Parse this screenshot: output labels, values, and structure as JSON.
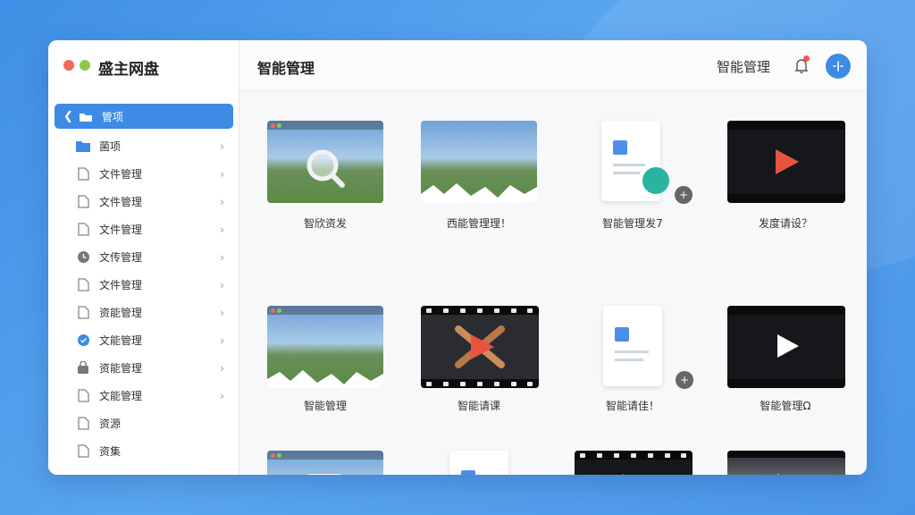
{
  "app": {
    "title": "盛主网盘"
  },
  "sidebar": {
    "items": [
      {
        "label": "管项",
        "icon": "folder-cloud-icon"
      },
      {
        "label": "菌项",
        "icon": "folder-icon"
      },
      {
        "label": "文件管理",
        "icon": "file-icon"
      },
      {
        "label": "文件管理",
        "icon": "file-icon"
      },
      {
        "label": "文件管理",
        "icon": "file-icon"
      },
      {
        "label": "文传管理",
        "icon": "clock-icon"
      },
      {
        "label": "文件管理",
        "icon": "file-icon"
      },
      {
        "label": "资能管理",
        "icon": "file-icon"
      },
      {
        "label": "文能管理",
        "icon": "check-circle-icon"
      },
      {
        "label": "资能管理",
        "icon": "lock-icon"
      },
      {
        "label": "文能管理",
        "icon": "file-icon"
      },
      {
        "label": "资源",
        "icon": "file-icon"
      },
      {
        "label": "资集",
        "icon": "file-icon"
      }
    ]
  },
  "header": {
    "title": "智能管理",
    "right_label": "智能管理"
  },
  "grid": {
    "items": [
      {
        "label": "智欣资发",
        "kind": "image-search"
      },
      {
        "label": "西能管理理！",
        "kind": "image"
      },
      {
        "label": "智能管理发7",
        "kind": "document-app"
      },
      {
        "label": "发度请设？",
        "kind": "video"
      },
      {
        "label": "智能管理",
        "kind": "image"
      },
      {
        "label": "智能请课",
        "kind": "video-film"
      },
      {
        "label": "智能请佳！",
        "kind": "document"
      },
      {
        "label": "智能管理Ω",
        "kind": "video"
      },
      {
        "label": "",
        "kind": "image-dialog"
      },
      {
        "label": "",
        "kind": "document"
      },
      {
        "label": "",
        "kind": "video-film"
      },
      {
        "label": "",
        "kind": "video-landscape"
      }
    ]
  },
  "colors": {
    "accent": "#3d8be4",
    "play": "#e8533f",
    "bell_dot": "#ef5a4e"
  }
}
